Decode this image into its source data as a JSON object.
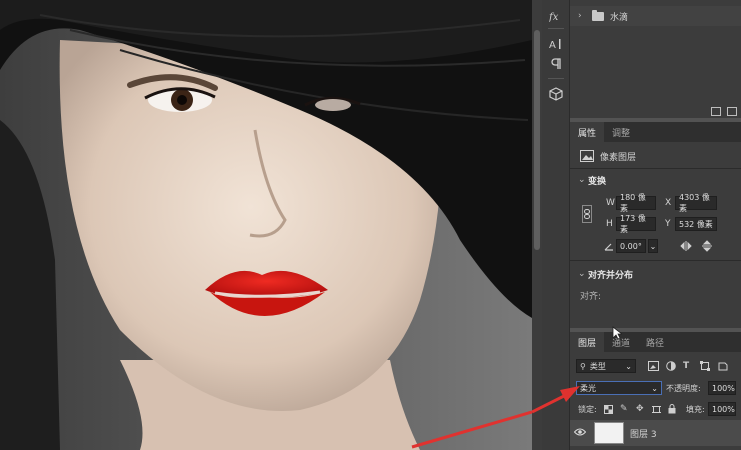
{
  "layers_panel_top": {
    "folder_name": "水滴"
  },
  "properties": {
    "tabs": [
      "属性",
      "调整"
    ],
    "layer_type": "像素图层",
    "transform_header": "变换",
    "w_label": "W",
    "w_value": "180 像素",
    "x_label": "X",
    "x_value": "4303 像素",
    "h_label": "H",
    "h_value": "173 像素",
    "y_label": "Y",
    "y_value": "532 像素",
    "angle_value": "0.00°",
    "align_header": "对齐并分布",
    "align_label": "对齐:"
  },
  "layers": {
    "tabs": [
      "图层",
      "通道",
      "路径"
    ],
    "filter_kind": "类型",
    "blend_mode": "柔光",
    "opacity_label": "不透明度:",
    "opacity_value": "100%",
    "lock_label": "锁定:",
    "fill_label": "填充:",
    "fill_value": "100%",
    "layer_name": "图层 3"
  },
  "colors": {
    "panel_bg": "#3c3c3c",
    "app_bg": "#535353",
    "annotation_arrow": "#e0322f",
    "lip_red": "#d6191b"
  },
  "icons": [
    "fx-icon",
    "character-icon",
    "paragraph-icon",
    "3d-cube-icon",
    "folder-icon",
    "eye-icon",
    "link-icon",
    "flip-horizontal-icon",
    "flip-vertical-icon"
  ]
}
